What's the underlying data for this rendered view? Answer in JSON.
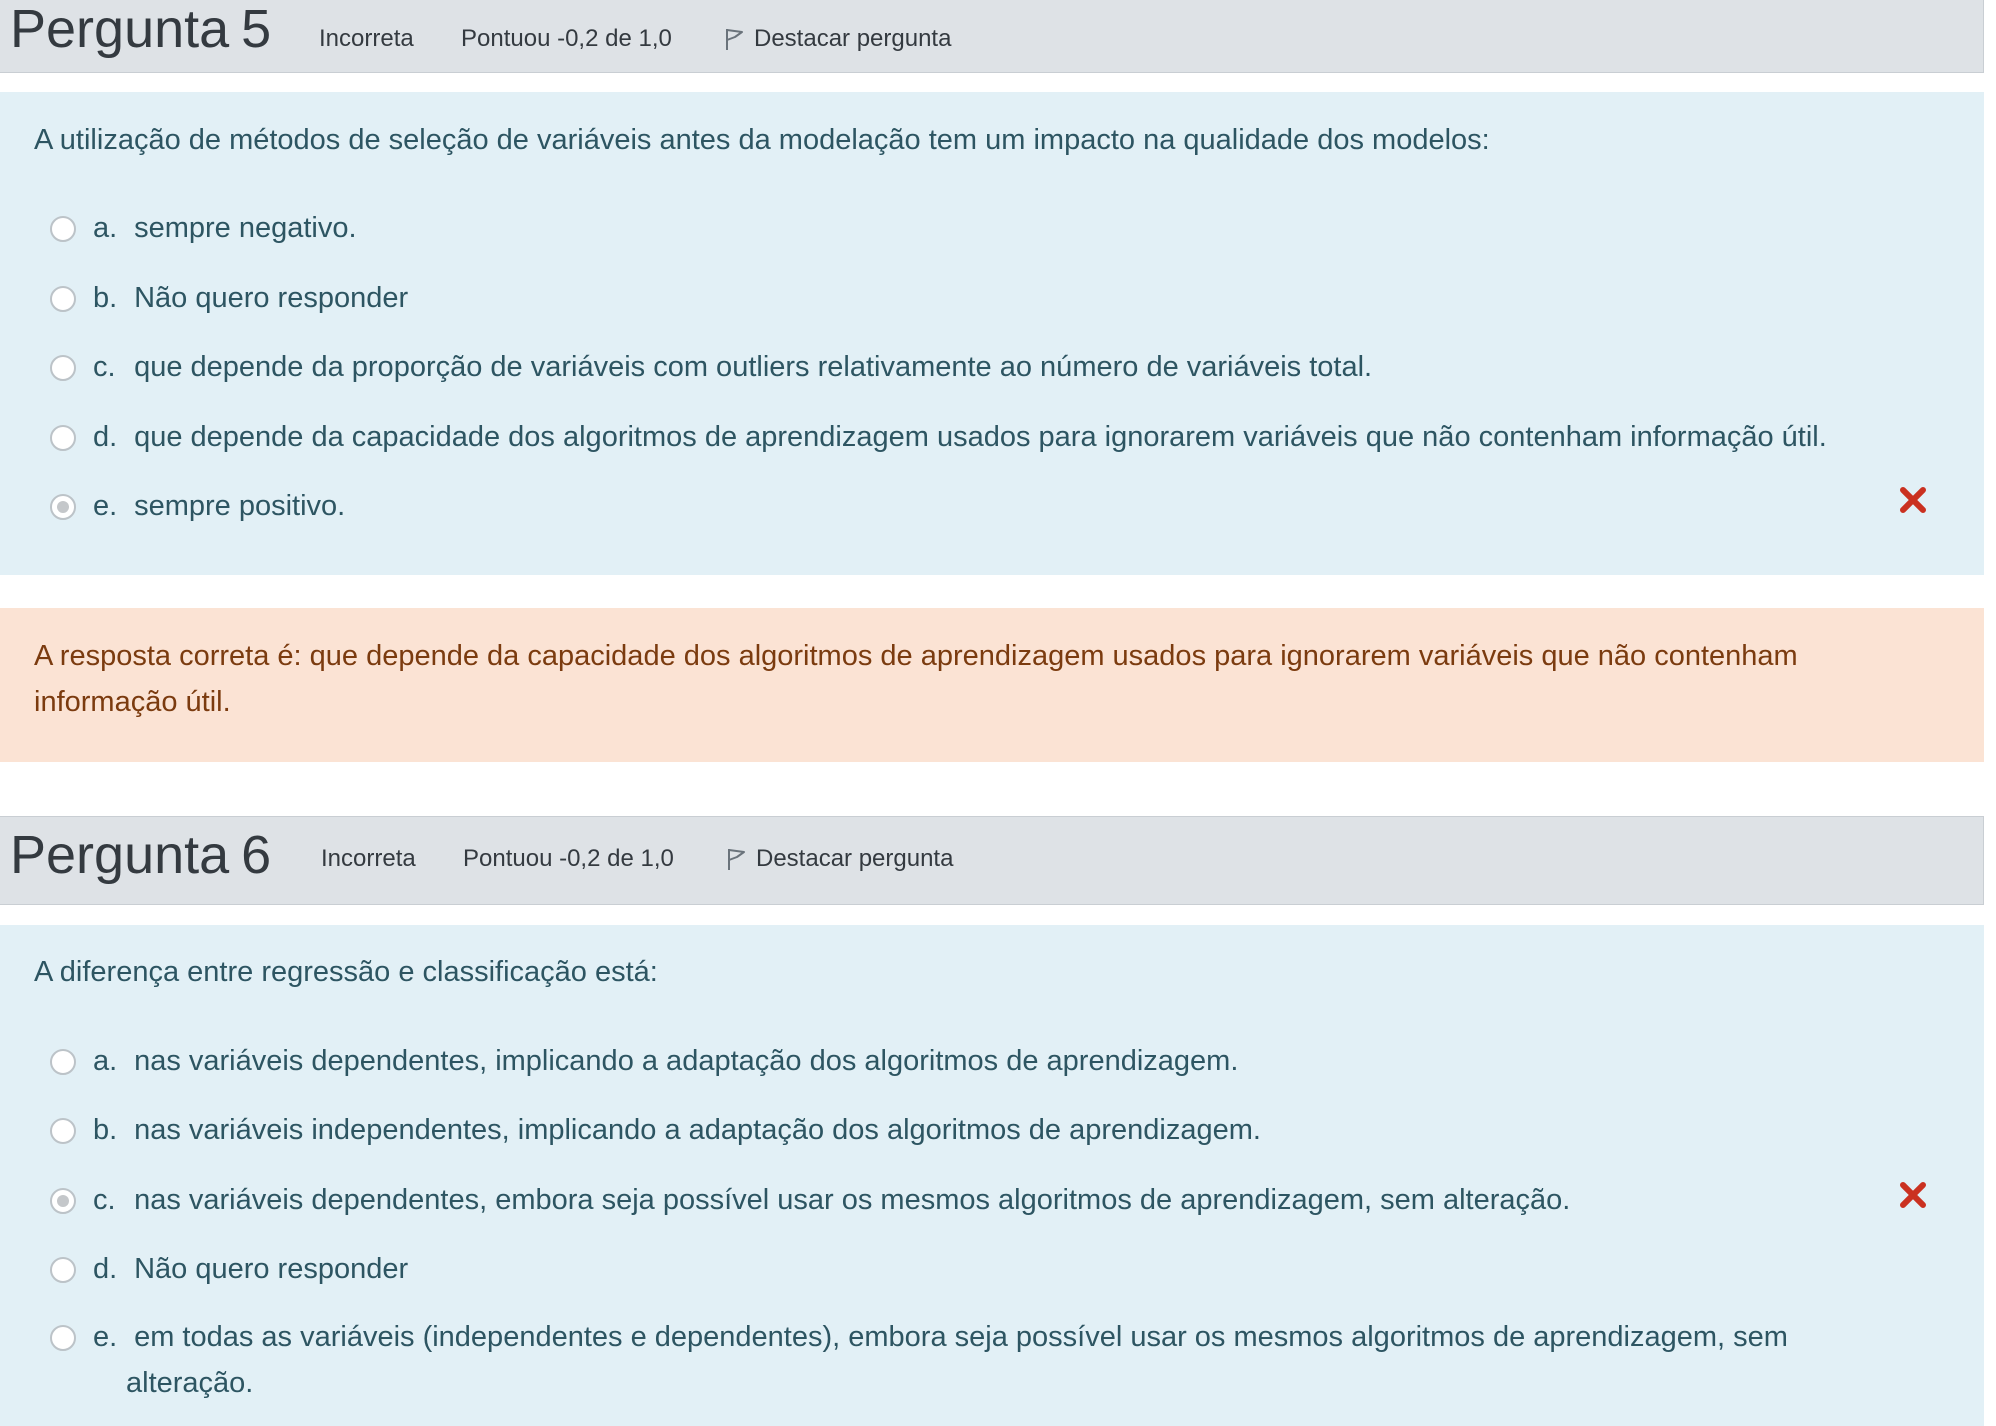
{
  "questions": [
    {
      "title_word": "Pergunta",
      "number": "5",
      "state": "Incorreta",
      "grade": "Pontuou -0,2 de 1,0",
      "flag_label": "Destacar pergunta",
      "text": "A utilização de métodos de seleção de variáveis antes da modelação tem um impacto na qualidade dos modelos:",
      "options": [
        {
          "letter": "a.",
          "text": "sempre negativo.",
          "checked": false
        },
        {
          "letter": "b.",
          "text": "Não quero responder",
          "checked": false
        },
        {
          "letter": "c.",
          "text": "que depende da proporção de variáveis com outliers relativamente ao número de variáveis total.",
          "checked": false
        },
        {
          "letter": "d.",
          "text": "que depende da capacidade dos algoritmos de aprendizagem usados para ignorarem variáveis que não contenham informação útil.",
          "checked": false
        },
        {
          "letter": "e.",
          "text": "sempre positivo.",
          "checked": true,
          "marked_incorrect": true
        }
      ],
      "feedback": "A resposta correta é: que depende da capacidade dos algoritmos de aprendizagem usados para ignorarem variáveis que não contenham informação útil."
    },
    {
      "title_word": "Pergunta",
      "number": "6",
      "state": "Incorreta",
      "grade": "Pontuou -0,2 de 1,0",
      "flag_label": "Destacar pergunta",
      "text": "A diferença entre regressão e classificação está:",
      "options": [
        {
          "letter": "a.",
          "text": "nas variáveis dependentes, implicando a adaptação dos algoritmos de aprendizagem.",
          "checked": false
        },
        {
          "letter": "b.",
          "text": "nas variáveis independentes, implicando a adaptação dos algoritmos de aprendizagem.",
          "checked": false
        },
        {
          "letter": "c.",
          "text": "nas variáveis dependentes, embora seja possível usar os mesmos algoritmos de aprendizagem, sem alteração.",
          "checked": true,
          "marked_incorrect": true
        },
        {
          "letter": "d.",
          "text": "Não quero responder",
          "checked": false
        },
        {
          "letter": "e.",
          "text": "em todas as variáveis (independentes e dependentes), embora seja possível usar os mesmos algoritmos de aprendizagem, sem",
          "text_cont": "alteração.",
          "checked": false
        }
      ]
    }
  ],
  "colors": {
    "header_bg": "#dee2e6",
    "question_bg": "#e2f0f6",
    "feedback_bg": "#fbe3d4",
    "incorrect_mark": "#ca3120"
  },
  "icons": {
    "flag": "flag-icon",
    "incorrect": "cross-icon"
  }
}
